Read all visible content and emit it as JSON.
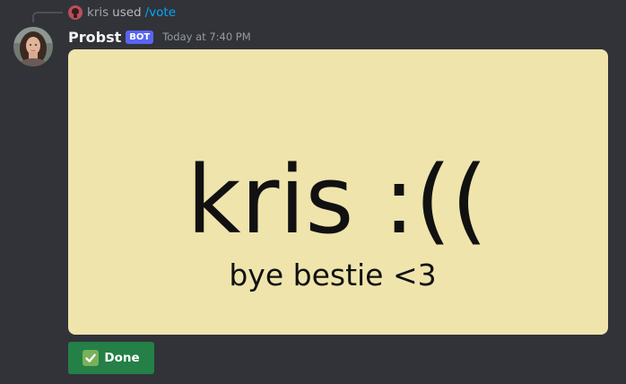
{
  "reply": {
    "user": "kris",
    "action": "used",
    "command": "/vote"
  },
  "message": {
    "author": "Probst",
    "bot_tag": "BOT",
    "timestamp": "Today at 7:40 PM"
  },
  "image": {
    "title": "kris :((",
    "subtitle": "bye bestie <3"
  },
  "components": {
    "done_label": "Done"
  },
  "colors": {
    "background": "#313338",
    "image_bg": "#f0e4ad",
    "button_green": "#248046",
    "bot_tag": "#5865f2",
    "command_link": "#00a8fc"
  },
  "icons": {
    "reply_avatar": "user-avatar-icon",
    "author_avatar": "bot-avatar",
    "done": "check-mark-icon"
  }
}
